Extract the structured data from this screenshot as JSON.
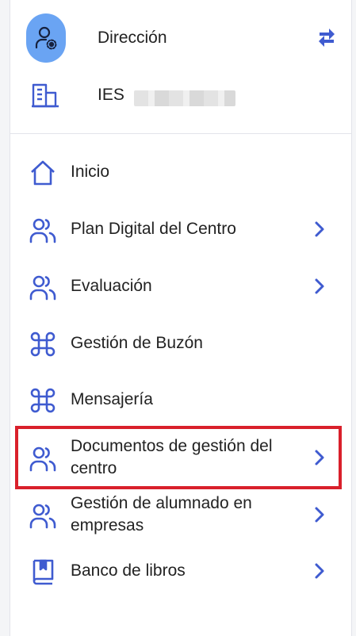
{
  "colors": {
    "accent": "#3f5bd0",
    "avatar_bg": "#6aa4f3",
    "highlight": "#d9202b"
  },
  "profile": {
    "role": "Dirección",
    "avatar_icon": "user-gear-icon",
    "switch_icon": "swap-arrows-icon"
  },
  "school": {
    "name": "IES",
    "icon": "building-icon"
  },
  "menu": {
    "items": [
      {
        "label": "Inicio",
        "icon": "home-icon",
        "has_submenu": false
      },
      {
        "label": "Plan Digital del Centro",
        "icon": "users-icon",
        "has_submenu": true
      },
      {
        "label": "Evaluación",
        "icon": "users-icon",
        "has_submenu": true
      },
      {
        "label": "Gestión de Buzón",
        "icon": "command-icon",
        "has_submenu": false
      },
      {
        "label": "Mensajería",
        "icon": "command-icon",
        "has_submenu": false
      },
      {
        "label": "Documentos de gestión del centro",
        "icon": "users-icon",
        "has_submenu": true,
        "highlighted": true
      },
      {
        "label": "Gestión de alumnado en empresas",
        "icon": "users-icon",
        "has_submenu": true
      },
      {
        "label": "Banco de libros",
        "icon": "book-icon",
        "has_submenu": true
      }
    ]
  }
}
